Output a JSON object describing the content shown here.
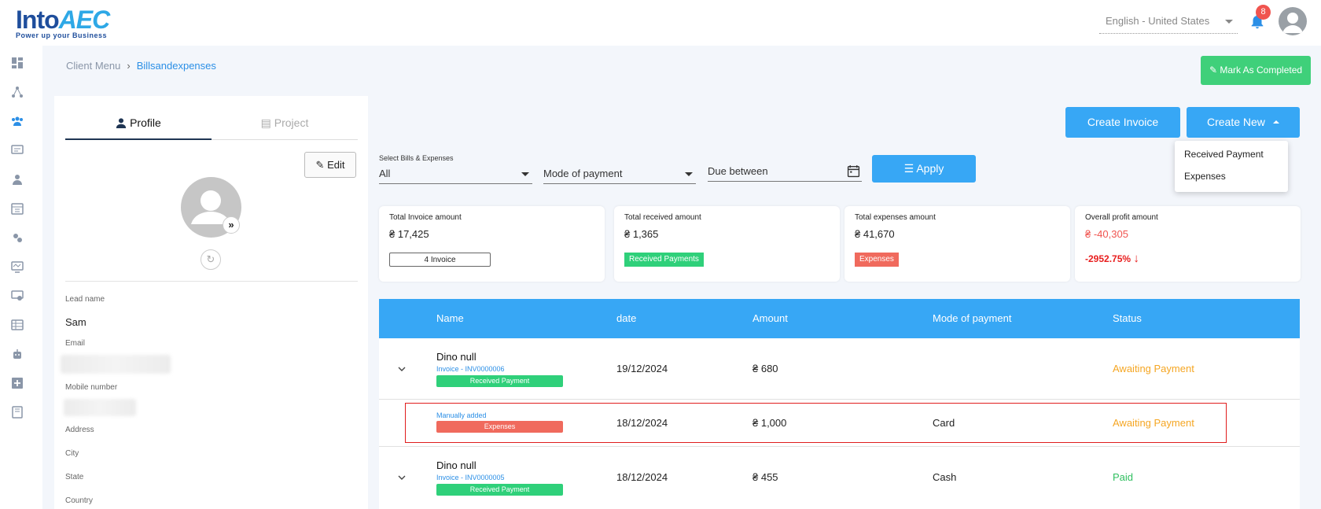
{
  "brand": {
    "logo_text_a": "Into",
    "logo_text_b": "AEC",
    "tagline": "Power up your Business"
  },
  "header": {
    "language": "English - United States",
    "notification_count": "8"
  },
  "breadcrumb": {
    "parent": "Client Menu",
    "current": "Billsandexpenses"
  },
  "actions": {
    "mark_completed": "Mark As Completed",
    "create_invoice": "Create Invoice",
    "create_new": "Create New"
  },
  "create_new_menu": {
    "items": [
      "Received Payment",
      "Expenses"
    ]
  },
  "profile": {
    "tabs": [
      "Profile",
      "Project"
    ],
    "edit_label": "Edit",
    "fields": {
      "lead_name_label": "Lead name",
      "lead_name_value": "Sam",
      "email_label": "Email",
      "mobile_label": "Mobile number",
      "address_label": "Address",
      "city_label": "City",
      "state_label": "State",
      "country_label": "Country"
    }
  },
  "filters": {
    "bills_label": "Select Bills & Expenses",
    "bills_value": "All",
    "mode_placeholder": "Mode of payment",
    "due_placeholder": "Due between",
    "apply_label": "Apply"
  },
  "summary": [
    {
      "title": "Total Invoice amount",
      "value": "₴ 17,425",
      "chip": "4 Invoice"
    },
    {
      "title": "Total received amount",
      "value": "₴ 1,365",
      "chip": "Received Payments"
    },
    {
      "title": "Total expenses amount",
      "value": "₴ 41,670",
      "chip": "Expenses"
    },
    {
      "title": "Overall profit amount",
      "value": "₴ -40,305",
      "percent": "-2952.75%"
    }
  ],
  "table": {
    "columns": [
      "Name",
      "date",
      "Amount",
      "Mode of payment",
      "Status"
    ],
    "rows": [
      {
        "name": "Dino null",
        "sub": "Invoice - INV0000006",
        "tag": "Received Payment",
        "date": "19/12/2024",
        "amount": "₴ 680",
        "mode": "",
        "status": "Awaiting Payment"
      },
      {
        "name": "",
        "sub": "Manually added",
        "tag": "Expenses",
        "date": "18/12/2024",
        "amount": "₴ 1,000",
        "mode": "Card",
        "status": "Awaiting Payment"
      },
      {
        "name": "Dino null",
        "sub": "Invoice - INV0000005",
        "tag": "Received Payment",
        "date": "18/12/2024",
        "amount": "₴ 455",
        "mode": "Cash",
        "status": "Paid"
      }
    ]
  },
  "colors": {
    "primary": "#37a7f5",
    "success": "#2fd07a",
    "danger": "#f06a5d",
    "warning": "#f5a623"
  }
}
